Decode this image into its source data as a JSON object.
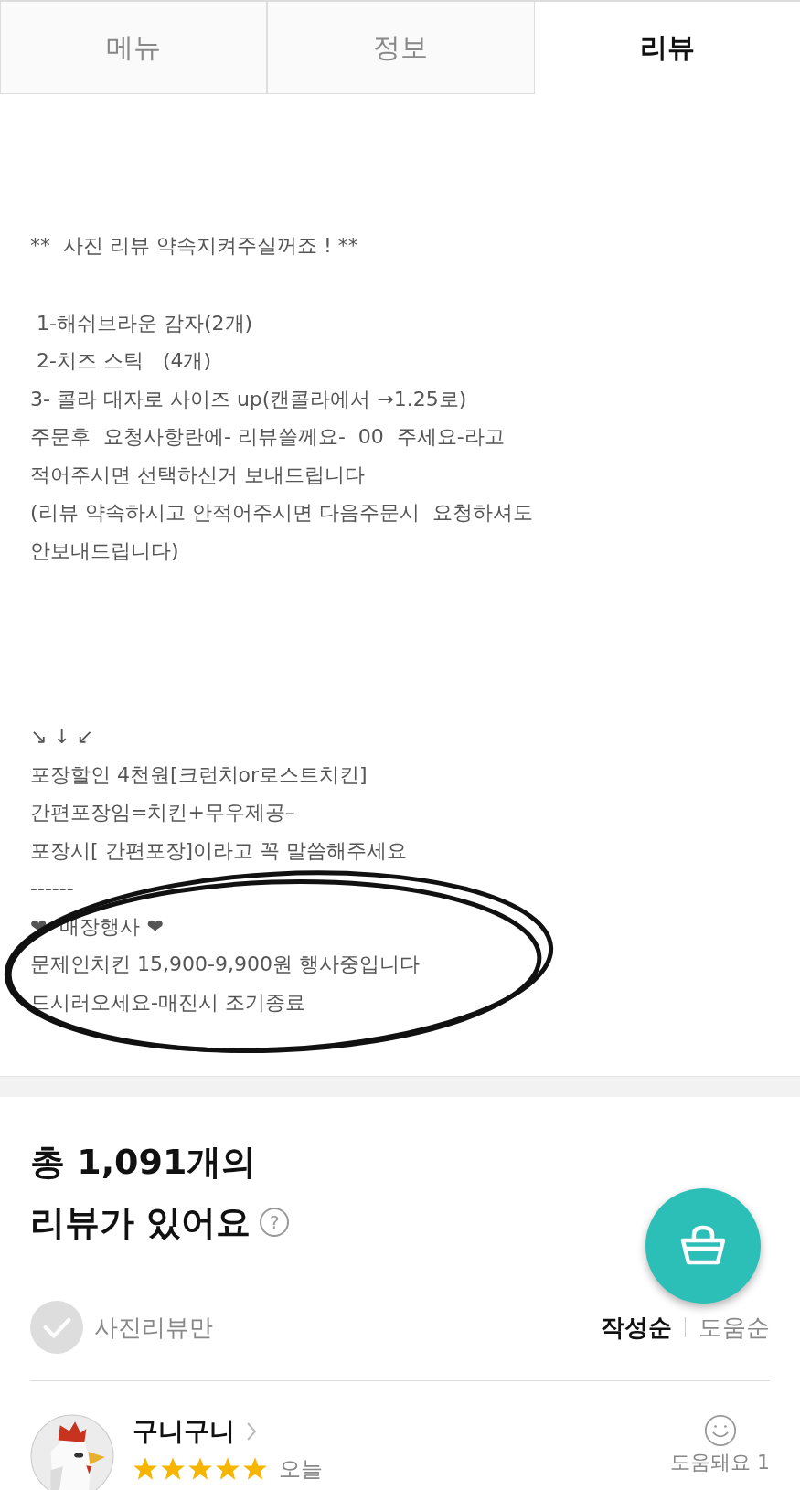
{
  "tabs": [
    {
      "label": "메뉴",
      "selected": false
    },
    {
      "label": "정보",
      "selected": false
    },
    {
      "label": "리뷰",
      "selected": true
    }
  ],
  "notice": {
    "blocks": [
      [
        "**  사진 리뷰 약속지켜주실꺼죠 ! **"
      ],
      [
        " 1-해쉬브라운 감자(2개)",
        " 2-치즈 스틱   (4개)",
        "3- 콜라 대자로 사이즈 up(캔콜라에서 →1.25로)",
        "주문후  요청사항란에- 리뷰쓸께요-  00  주세요-라고",
        "적어주시면 선택하신거 보내드립니다",
        "(리뷰 약속하시고 안적어주시면 다음주문시  요청하셔도",
        "안보내드립니다)"
      ],
      [
        "↘ ↓ ↙",
        "포장할인 4천원[크런치or로스트치킨]",
        "간편포장임=치킨+무우제공–",
        "포장시[ 간편포장]이라고 꼭 말씀해주세요",
        "------",
        "❤  매장행사 ❤",
        "문제인치킨 15,900-9,900원 행사중입니다",
        "드시러오세요-매진시 조기종료"
      ]
    ]
  },
  "reviews_header": {
    "title_lines": [
      "총 1,091개의",
      "리뷰가 있어요"
    ],
    "help": "?"
  },
  "photo_only": {
    "label": "사진리뷰만",
    "checked": false
  },
  "sort": [
    {
      "label": "작성순",
      "selected": true
    },
    {
      "label": "도움순",
      "selected": false
    }
  ],
  "review": {
    "author": "구니구니",
    "stars": 5,
    "date": "오늘",
    "helpful": "도움돼요 1"
  }
}
